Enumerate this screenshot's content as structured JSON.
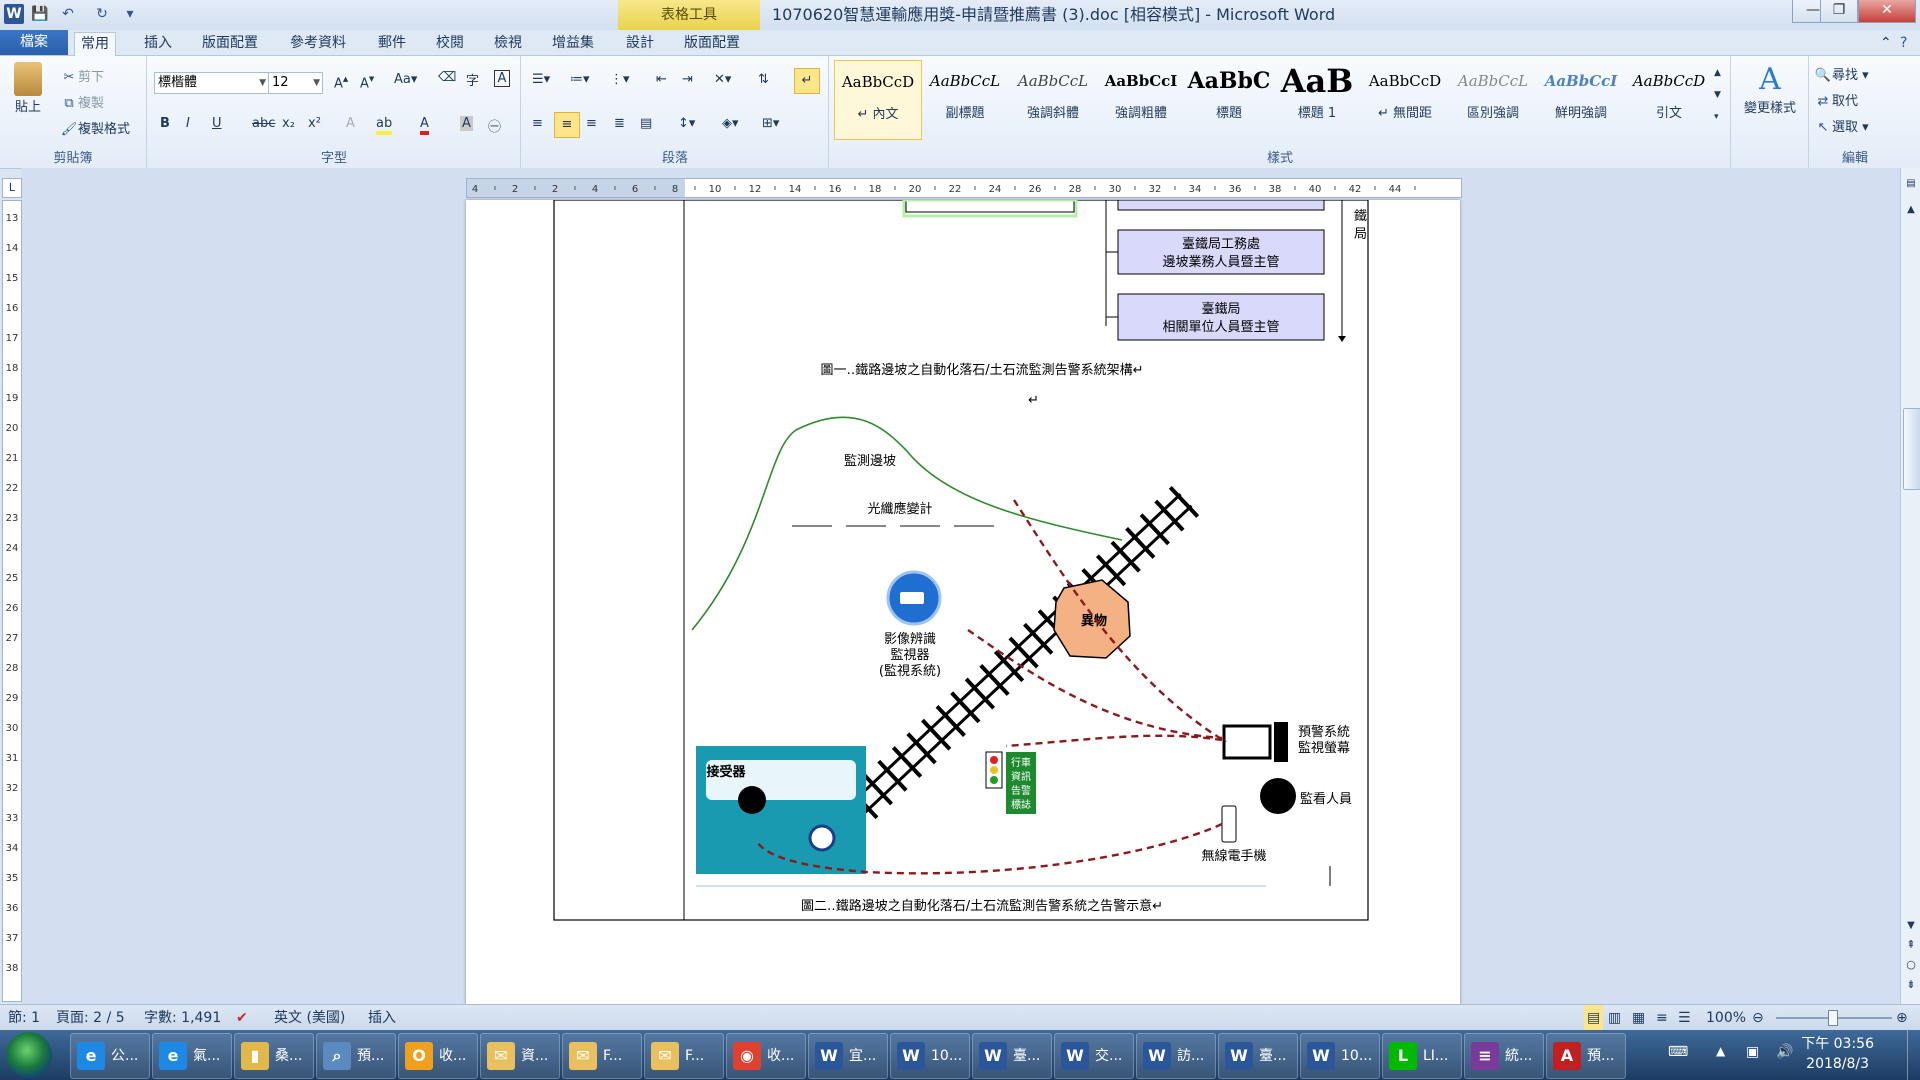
{
  "window": {
    "title": "1070620智慧運輸應用獎-申請暨推薦書 (3).doc [相容模式] - Microsoft Word",
    "context_tools": "表格工具"
  },
  "quick_access": [
    "W",
    "💾",
    "↶",
    "↻",
    "▾"
  ],
  "tabs": [
    "檔案",
    "常用",
    "插入",
    "版面配置",
    "參考資料",
    "郵件",
    "校閱",
    "檢視",
    "增益集",
    "設計",
    "版面配置"
  ],
  "clipboard": {
    "paste": "貼上",
    "cut": "剪下",
    "copy": "複製",
    "format_painter": "複製格式",
    "label": "剪貼簿"
  },
  "font": {
    "name": "標楷體",
    "size": "12",
    "label": "字型",
    "buttons": [
      "B",
      "I",
      "U",
      "abc",
      "x₂",
      "x²",
      "A",
      "A"
    ]
  },
  "paragraph": {
    "label": "段落"
  },
  "styles": {
    "label": "樣式",
    "items": [
      {
        "preview": "AaBbCcD",
        "name": "↵ 內文"
      },
      {
        "preview": "AaBbCcL",
        "name": "副標題"
      },
      {
        "preview": "AaBbCcL",
        "name": "強調斜體"
      },
      {
        "preview": "AaBbCcI",
        "name": "強調粗體"
      },
      {
        "preview": "AaBbC",
        "name": "標題"
      },
      {
        "preview": "AaB",
        "name": "標題 1"
      },
      {
        "preview": "AaBbCcD",
        "name": "↵ 無間距"
      },
      {
        "preview": "AaBbCcL",
        "name": "區別強調"
      },
      {
        "preview": "AaBbCcI",
        "name": "鮮明強調"
      },
      {
        "preview": "AaBbCcD",
        "name": "引文"
      }
    ],
    "change_styles": "變更樣式"
  },
  "editing": {
    "find": "尋找",
    "replace": "取代",
    "select": "選取",
    "label": "編輯"
  },
  "ruler_numbers": [
    "4",
    "2",
    "2",
    "4",
    "6",
    "8",
    "10",
    "12",
    "14",
    "16",
    "18",
    "20",
    "22",
    "24",
    "26",
    "28",
    "30",
    "32",
    "34",
    "36",
    "38",
    "40",
    "42",
    "44"
  ],
  "vruler_numbers": [
    "13",
    "14",
    "15",
    "16",
    "17",
    "18",
    "19",
    "20",
    "21",
    "22",
    "23",
    "24",
    "25",
    "26",
    "27",
    "28",
    "29",
    "30",
    "31",
    "32",
    "33",
    "34",
    "35",
    "36",
    "37",
    "38"
  ],
  "document": {
    "org_boxes": [
      "臺鐵局工務處\n邊坡業務人員暨主管",
      "臺鐵局\n相關單位人員暨主管"
    ],
    "side_label": "鐵\n局",
    "caption1": "圖一‥鐵路邊坡之自動化落石/土石流監測告警系統架構↵",
    "para_mark": "↵",
    "figure2": {
      "slope_label": "監測邊坡",
      "sensor_label": "光纖應變計",
      "camera_label": [
        "影像辨識",
        "監視器",
        "(監視系統)"
      ],
      "obstacle_label": "異物",
      "alert_screen_label": [
        "預警系統",
        "監視螢幕"
      ],
      "monitor_person_label": "監看人員",
      "radio_label": "無線電手機",
      "receiver_label": "接受器",
      "signal_label": [
        "行車",
        "資訊",
        "告警",
        "標誌"
      ]
    },
    "caption2": "圖二‥鐵路邊坡之自動化落石/土石流監測告警系統之告警示意↵"
  },
  "status": {
    "section": "節: 1",
    "page": "頁面: 2 / 5",
    "words": "字數: 1,491",
    "language": "英文 (美國)",
    "mode": "插入",
    "zoom": "100%"
  },
  "taskbar": {
    "items": [
      {
        "icon": "e",
        "label": "公..."
      },
      {
        "icon": "e",
        "label": "氣..."
      },
      {
        "icon": "▮",
        "label": "桑..."
      },
      {
        "icon": "⌕",
        "label": "預..."
      },
      {
        "icon": "O",
        "label": "收..."
      },
      {
        "icon": "✉",
        "label": "資..."
      },
      {
        "icon": "✉",
        "label": "F..."
      },
      {
        "icon": "✉",
        "label": "F..."
      },
      {
        "icon": "◉",
        "label": "收..."
      },
      {
        "icon": "W",
        "label": "宜..."
      },
      {
        "icon": "W",
        "label": "10..."
      },
      {
        "icon": "W",
        "label": "臺..."
      },
      {
        "icon": "W",
        "label": "交..."
      },
      {
        "icon": "W",
        "label": "訪..."
      },
      {
        "icon": "W",
        "label": "臺..."
      },
      {
        "icon": "W",
        "label": "10..."
      },
      {
        "icon": "L",
        "label": "LI..."
      },
      {
        "icon": "≡",
        "label": "統..."
      },
      {
        "icon": "A",
        "label": "預..."
      }
    ],
    "clock_time": "下午 03:56",
    "clock_date": "2018/8/3"
  },
  "colors": {
    "ribbon_bg": "#e3ecf7",
    "file_tab": "#2b5fa8",
    "context_tab": "#e9d14f",
    "curve": "#2e8b2e",
    "arrow": "#8b1a1a",
    "obstacle": "#f4b183"
  }
}
